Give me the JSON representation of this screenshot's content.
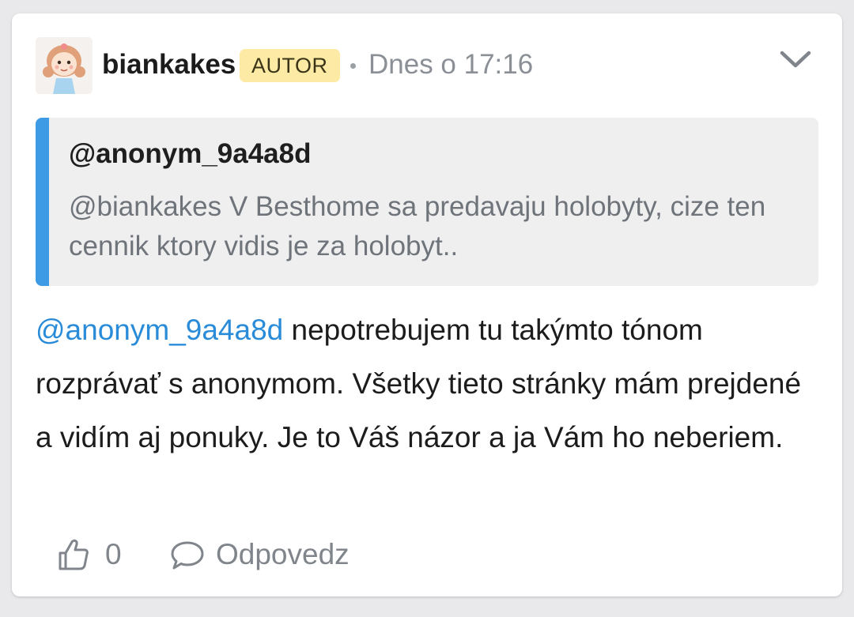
{
  "post": {
    "author": {
      "username": "biankakes",
      "badge": "AUTOR"
    },
    "timestamp": "Dnes o 17:16",
    "menu_icon": "chevron-down-icon",
    "quote": {
      "author": "@anonym_9a4a8d",
      "text": "@biankakes V Besthome sa predavaju holobyty, cize ten cennik ktory vidis je za holobyt.."
    },
    "body": {
      "mention": "@anonym_9a4a8d",
      "text": " nepotrebujem tu takýmto tónom rozprávať s anonymom. Všetky tieto stránky mám prejdené a vidím aj ponuky. Je to Váš názor a ja Vám ho neberiem."
    },
    "actions": {
      "like_icon": "thumbs-up-icon",
      "like_count": "0",
      "reply_icon": "speech-bubble-icon",
      "reply_label": "Odpovedz"
    }
  },
  "colors": {
    "accent": "#3d9be6",
    "mention": "#2a8cd8",
    "badge_bg": "#fdeaa4",
    "muted": "#8b8f96"
  }
}
